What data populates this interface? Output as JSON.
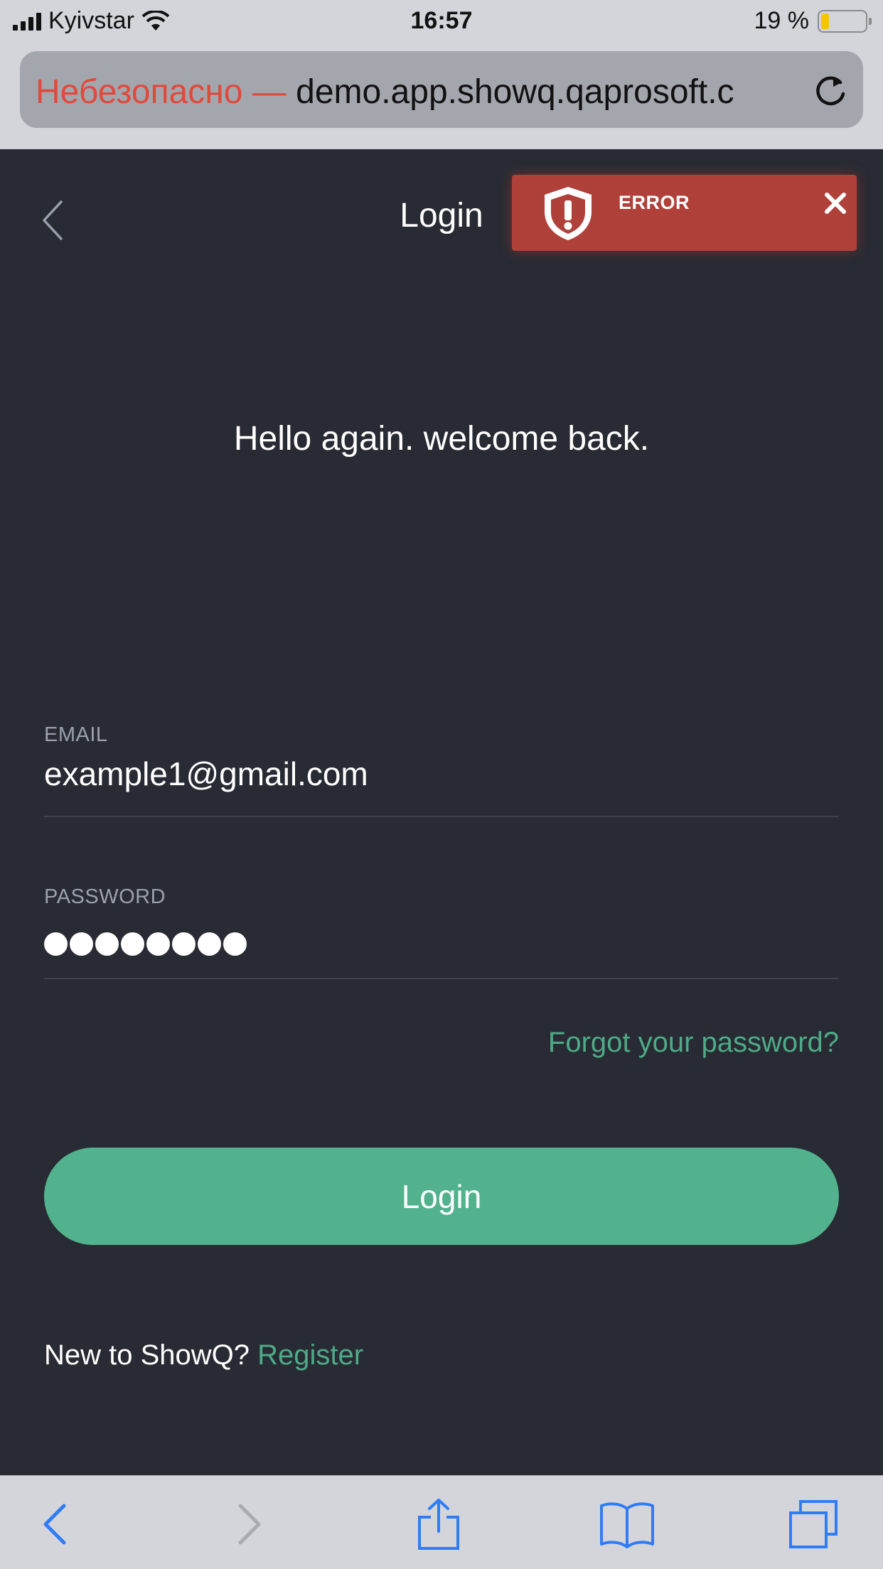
{
  "status_bar": {
    "carrier": "Kyivstar",
    "time": "16:57",
    "battery_text": "19 %",
    "battery_level": 0.19
  },
  "browser": {
    "url_warning": "Небезопасно —",
    "url_host": " demo.app.showq.qaprosoft.c",
    "reload_icon": "reload-icon"
  },
  "header": {
    "title": "Login"
  },
  "error_toast": {
    "title": "ERROR",
    "icon": "shield-exclamation-icon",
    "color": "#b0403a"
  },
  "greeting": "Hello again. welcome back.",
  "form": {
    "email_label": "EMAIL",
    "email_value": "example1@gmail.com",
    "password_label": "PASSWORD",
    "password_length": 8,
    "forgot_link": "Forgot your password?",
    "login_button": "Login"
  },
  "footer": {
    "new_text": "New to ShowQ? ",
    "register_link": "Register"
  },
  "colors": {
    "background": "#282b33",
    "accent": "#53b28e",
    "error": "#b0403a"
  },
  "toolbar": {
    "icons": [
      "back-icon",
      "forward-icon",
      "share-icon",
      "bookmarks-icon",
      "tabs-icon"
    ]
  }
}
